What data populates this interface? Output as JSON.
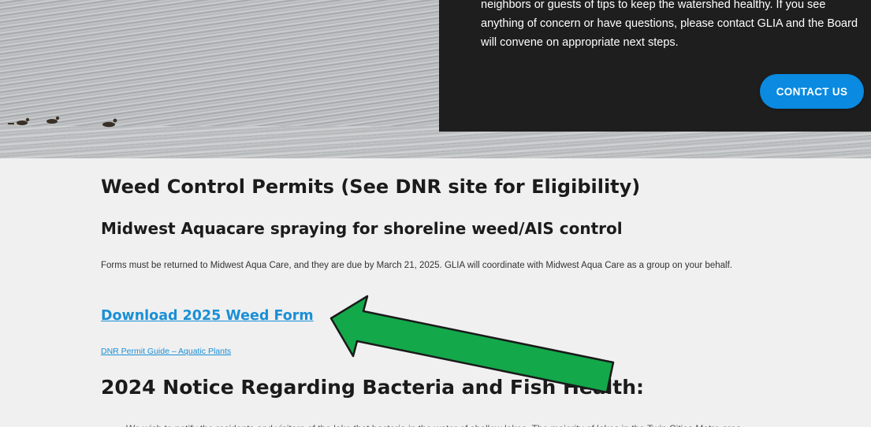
{
  "hero": {
    "panel_lines": [
      "neighbors or guests of tips to keep the watershed healthy. If you see",
      "anything of concern or have questions, please contact GLIA and the Board",
      "will convene on appropriate next steps."
    ],
    "contact_label": "CONTACT US"
  },
  "content": {
    "main_title": "Weed Control Permits (See DNR site for Eligibility)",
    "sub_title": "Midwest Aquacare spraying for shoreline weed/AIS control",
    "note": "Forms must be returned to Midwest Aqua Care, and they are due by March 21, 2025. GLIA will coordinate with Midwest Aqua Care as a group on your behalf.",
    "download_link": "Download 2025 Weed Form",
    "dnr_link": "DNR Permit Guide – Aquatic Plants",
    "notice_title": "2024 Notice Regarding Bacteria and Fish Health:",
    "cut_text": "We wish to notify the residents and visitors of the lake that bacteria in the water of shallow lakes. The majority of lakes in the Twin Cities Metro area"
  },
  "colors": {
    "accent": "#0a8ae0",
    "link": "#1a8fd6",
    "arrow_fill": "#13a84a",
    "panel": "#1e1e1e",
    "content_bg": "#f0f0f0"
  }
}
